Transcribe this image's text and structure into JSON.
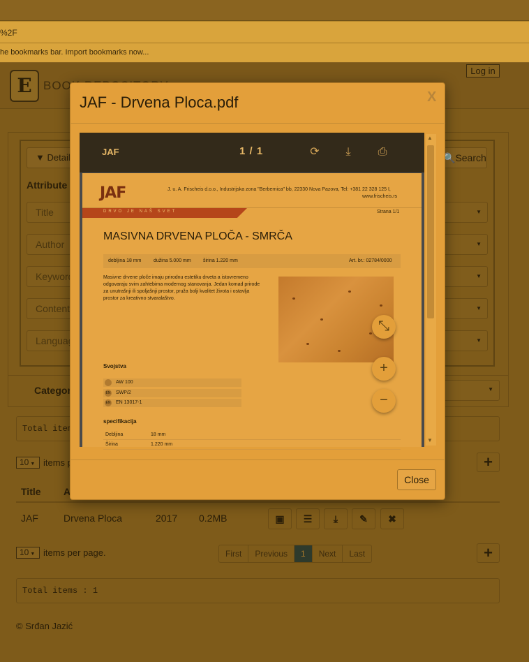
{
  "browser": {
    "url_fragment": "%2F",
    "bookmarks_text": "he bookmarks bar. Import bookmarks now..."
  },
  "header": {
    "brand": "BOOK REPOSITORY",
    "login_label": "Log in"
  },
  "search": {
    "details_label": "Detail",
    "search_label": "Search",
    "attribute_heading": "Attribute",
    "fields": [
      {
        "placeholder": "Title"
      },
      {
        "placeholder": "Author"
      },
      {
        "placeholder": "Keyword"
      },
      {
        "placeholder": "Content"
      },
      {
        "placeholder": "Languag"
      }
    ],
    "category_label": "Category"
  },
  "list": {
    "total_top": "Total items",
    "per_page_value": "10",
    "per_page_label_top": "items p",
    "per_page_label": "items per page.",
    "columns": [
      "Title",
      "A"
    ],
    "rows": [
      {
        "title": "JAF",
        "author": "Drvena Ploca",
        "year": "2017",
        "size": "0.2MB"
      }
    ],
    "pager": [
      "First",
      "Previous",
      "1",
      "Next",
      "Last"
    ],
    "pager_active": "1",
    "total_bottom": "Total items : 1"
  },
  "footer": {
    "copyright": "© Srđan Jazić"
  },
  "modal": {
    "title": "JAF - Drvena Ploca.pdf",
    "close_x": "X",
    "close_button": "Close",
    "viewer": {
      "doc_title": "JAF",
      "page_indicator": "1 / 1"
    },
    "pdf": {
      "logo": "JAF",
      "company_line": "J. u. A. Frischeis d.o.o., Industrijska zona \"Berbernica\" bb, 22330 Nova Pazova, Tel: +381 22 328 125 I,",
      "website": "www.frischeis.rs",
      "slogan": "DRVO JE NAŠ SVET",
      "page_label": "Strana 1/1",
      "product_title": "MASIVNA DRVENA PLOČA - SMRČA",
      "dimensions": {
        "debljina": "debljina 18 mm",
        "duzina": "dužina 5.000 mm",
        "sirina": "širina 1.220 mm",
        "art": "Art. br.: 02784/0000"
      },
      "description": "Masivne drvene ploče imaju prirodnu estetiku drveta a istovremeno odgovaraju svim zahtebima modernog stanovanja. Jedan komad prirode za unutrašnji ili spoljašnji prostor, pruža bolji kvalitet života i ostavlja prostor za kreativno stvaralaštvo.",
      "properties_heading": "Svojstva",
      "properties": [
        {
          "icon": "",
          "text": "AW 100"
        },
        {
          "icon": "EN",
          "text": "SWP/2"
        },
        {
          "icon": "EN",
          "text": "EN 13017-1"
        }
      ],
      "spec_heading": "specifikacija",
      "specs": [
        {
          "key": "Debljina",
          "value": "18 mm"
        },
        {
          "key": "Širina",
          "value": "1.220 mm"
        }
      ]
    }
  }
}
